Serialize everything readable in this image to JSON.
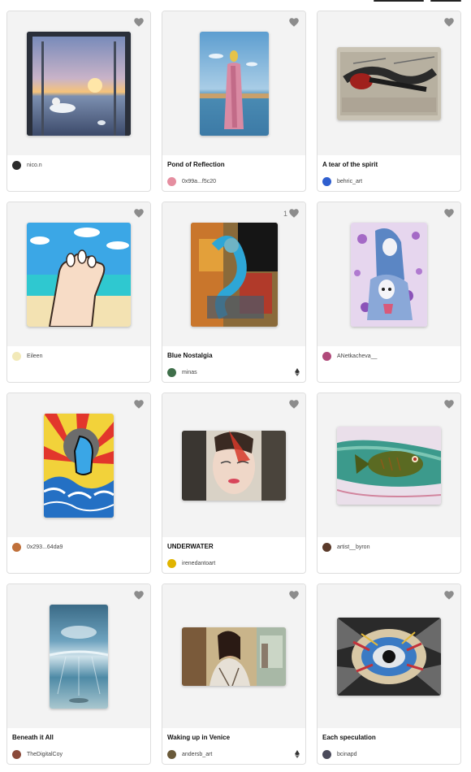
{
  "colors": {
    "accent": "#111111",
    "card_bg": "#f3f3f3",
    "border": "#dedede",
    "heart": "#8c8c8c"
  },
  "cards": [
    {
      "title": "",
      "owner": "nico.n",
      "likes": "",
      "eth": false,
      "avatar": "#2b2b2b"
    },
    {
      "title": "Pond of Reflection",
      "owner": "0x99a...f5c20",
      "likes": "",
      "eth": false,
      "avatar": "#e58ea0"
    },
    {
      "title": "A tear of the spirit",
      "owner": "behric_art",
      "likes": "",
      "eth": false,
      "avatar": "#2f5fcf"
    },
    {
      "title": "",
      "owner": "Eileen",
      "likes": "",
      "eth": false,
      "avatar": "#f2e9b8"
    },
    {
      "title": "Blue Nostalgia",
      "owner": "minas",
      "likes": "1",
      "eth": true,
      "avatar": "#3f6f4a"
    },
    {
      "title": "",
      "owner": "ANetkacheva__",
      "likes": "",
      "eth": false,
      "avatar": "#b04a7a"
    },
    {
      "title": "",
      "owner": "0x293...64da9",
      "likes": "",
      "eth": false,
      "avatar": "#c0703a"
    },
    {
      "title": "UNDERWATER",
      "owner": "irenedantoart",
      "likes": "",
      "eth": false,
      "avatar": "#e0b400"
    },
    {
      "title": "",
      "owner": "artist__byron",
      "likes": "",
      "eth": false,
      "avatar": "#5a3a2a"
    },
    {
      "title": "Beneath it All",
      "owner": "TheDigitalCoy",
      "likes": "",
      "eth": false,
      "avatar": "#8a4a3a"
    },
    {
      "title": "Waking up in Venice",
      "owner": "andersb_art",
      "likes": "",
      "eth": true,
      "avatar": "#6a5a3a"
    },
    {
      "title": "Each speculation",
      "owner": "bcinapd",
      "likes": "",
      "eth": false,
      "avatar": "#4a4a5a"
    }
  ]
}
